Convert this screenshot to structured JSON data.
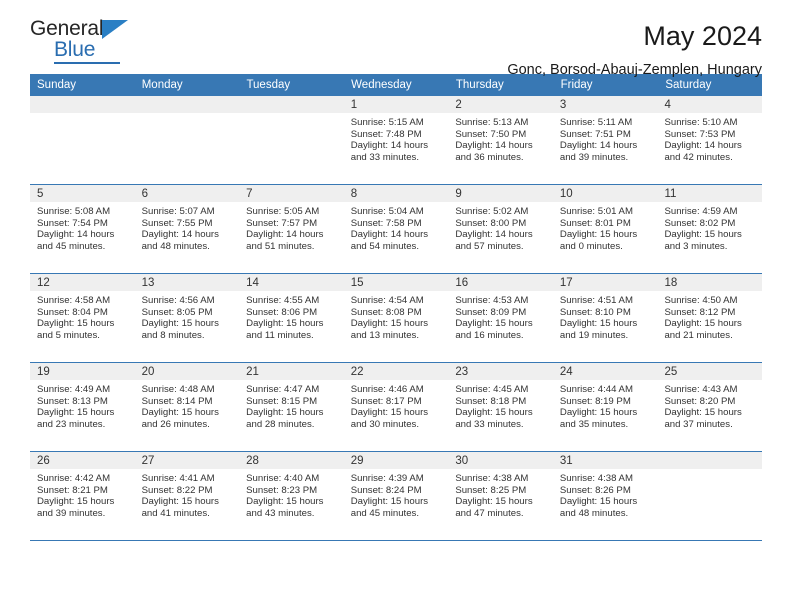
{
  "brand": {
    "name_top": "General",
    "name_bottom": "Blue",
    "triangle_icon": "blue-triangle-icon",
    "accent_color": "#2a6db0"
  },
  "header": {
    "title": "May 2024",
    "subtitle": "Gonc, Borsod-Abauj-Zemplen, Hungary"
  },
  "calendar": {
    "header_bg": "#3878b4",
    "band_bg": "#efefef",
    "weekdays": [
      "Sunday",
      "Monday",
      "Tuesday",
      "Wednesday",
      "Thursday",
      "Friday",
      "Saturday"
    ],
    "weeks": [
      [
        {
          "day": "",
          "sunrise": "",
          "sunset": "",
          "daylight1": "",
          "daylight2": ""
        },
        {
          "day": "",
          "sunrise": "",
          "sunset": "",
          "daylight1": "",
          "daylight2": ""
        },
        {
          "day": "",
          "sunrise": "",
          "sunset": "",
          "daylight1": "",
          "daylight2": ""
        },
        {
          "day": "1",
          "sunrise": "Sunrise: 5:15 AM",
          "sunset": "Sunset: 7:48 PM",
          "daylight1": "Daylight: 14 hours",
          "daylight2": "and 33 minutes."
        },
        {
          "day": "2",
          "sunrise": "Sunrise: 5:13 AM",
          "sunset": "Sunset: 7:50 PM",
          "daylight1": "Daylight: 14 hours",
          "daylight2": "and 36 minutes."
        },
        {
          "day": "3",
          "sunrise": "Sunrise: 5:11 AM",
          "sunset": "Sunset: 7:51 PM",
          "daylight1": "Daylight: 14 hours",
          "daylight2": "and 39 minutes."
        },
        {
          "day": "4",
          "sunrise": "Sunrise: 5:10 AM",
          "sunset": "Sunset: 7:53 PM",
          "daylight1": "Daylight: 14 hours",
          "daylight2": "and 42 minutes."
        }
      ],
      [
        {
          "day": "5",
          "sunrise": "Sunrise: 5:08 AM",
          "sunset": "Sunset: 7:54 PM",
          "daylight1": "Daylight: 14 hours",
          "daylight2": "and 45 minutes."
        },
        {
          "day": "6",
          "sunrise": "Sunrise: 5:07 AM",
          "sunset": "Sunset: 7:55 PM",
          "daylight1": "Daylight: 14 hours",
          "daylight2": "and 48 minutes."
        },
        {
          "day": "7",
          "sunrise": "Sunrise: 5:05 AM",
          "sunset": "Sunset: 7:57 PM",
          "daylight1": "Daylight: 14 hours",
          "daylight2": "and 51 minutes."
        },
        {
          "day": "8",
          "sunrise": "Sunrise: 5:04 AM",
          "sunset": "Sunset: 7:58 PM",
          "daylight1": "Daylight: 14 hours",
          "daylight2": "and 54 minutes."
        },
        {
          "day": "9",
          "sunrise": "Sunrise: 5:02 AM",
          "sunset": "Sunset: 8:00 PM",
          "daylight1": "Daylight: 14 hours",
          "daylight2": "and 57 minutes."
        },
        {
          "day": "10",
          "sunrise": "Sunrise: 5:01 AM",
          "sunset": "Sunset: 8:01 PM",
          "daylight1": "Daylight: 15 hours",
          "daylight2": "and 0 minutes."
        },
        {
          "day": "11",
          "sunrise": "Sunrise: 4:59 AM",
          "sunset": "Sunset: 8:02 PM",
          "daylight1": "Daylight: 15 hours",
          "daylight2": "and 3 minutes."
        }
      ],
      [
        {
          "day": "12",
          "sunrise": "Sunrise: 4:58 AM",
          "sunset": "Sunset: 8:04 PM",
          "daylight1": "Daylight: 15 hours",
          "daylight2": "and 5 minutes."
        },
        {
          "day": "13",
          "sunrise": "Sunrise: 4:56 AM",
          "sunset": "Sunset: 8:05 PM",
          "daylight1": "Daylight: 15 hours",
          "daylight2": "and 8 minutes."
        },
        {
          "day": "14",
          "sunrise": "Sunrise: 4:55 AM",
          "sunset": "Sunset: 8:06 PM",
          "daylight1": "Daylight: 15 hours",
          "daylight2": "and 11 minutes."
        },
        {
          "day": "15",
          "sunrise": "Sunrise: 4:54 AM",
          "sunset": "Sunset: 8:08 PM",
          "daylight1": "Daylight: 15 hours",
          "daylight2": "and 13 minutes."
        },
        {
          "day": "16",
          "sunrise": "Sunrise: 4:53 AM",
          "sunset": "Sunset: 8:09 PM",
          "daylight1": "Daylight: 15 hours",
          "daylight2": "and 16 minutes."
        },
        {
          "day": "17",
          "sunrise": "Sunrise: 4:51 AM",
          "sunset": "Sunset: 8:10 PM",
          "daylight1": "Daylight: 15 hours",
          "daylight2": "and 19 minutes."
        },
        {
          "day": "18",
          "sunrise": "Sunrise: 4:50 AM",
          "sunset": "Sunset: 8:12 PM",
          "daylight1": "Daylight: 15 hours",
          "daylight2": "and 21 minutes."
        }
      ],
      [
        {
          "day": "19",
          "sunrise": "Sunrise: 4:49 AM",
          "sunset": "Sunset: 8:13 PM",
          "daylight1": "Daylight: 15 hours",
          "daylight2": "and 23 minutes."
        },
        {
          "day": "20",
          "sunrise": "Sunrise: 4:48 AM",
          "sunset": "Sunset: 8:14 PM",
          "daylight1": "Daylight: 15 hours",
          "daylight2": "and 26 minutes."
        },
        {
          "day": "21",
          "sunrise": "Sunrise: 4:47 AM",
          "sunset": "Sunset: 8:15 PM",
          "daylight1": "Daylight: 15 hours",
          "daylight2": "and 28 minutes."
        },
        {
          "day": "22",
          "sunrise": "Sunrise: 4:46 AM",
          "sunset": "Sunset: 8:17 PM",
          "daylight1": "Daylight: 15 hours",
          "daylight2": "and 30 minutes."
        },
        {
          "day": "23",
          "sunrise": "Sunrise: 4:45 AM",
          "sunset": "Sunset: 8:18 PM",
          "daylight1": "Daylight: 15 hours",
          "daylight2": "and 33 minutes."
        },
        {
          "day": "24",
          "sunrise": "Sunrise: 4:44 AM",
          "sunset": "Sunset: 8:19 PM",
          "daylight1": "Daylight: 15 hours",
          "daylight2": "and 35 minutes."
        },
        {
          "day": "25",
          "sunrise": "Sunrise: 4:43 AM",
          "sunset": "Sunset: 8:20 PM",
          "daylight1": "Daylight: 15 hours",
          "daylight2": "and 37 minutes."
        }
      ],
      [
        {
          "day": "26",
          "sunrise": "Sunrise: 4:42 AM",
          "sunset": "Sunset: 8:21 PM",
          "daylight1": "Daylight: 15 hours",
          "daylight2": "and 39 minutes."
        },
        {
          "day": "27",
          "sunrise": "Sunrise: 4:41 AM",
          "sunset": "Sunset: 8:22 PM",
          "daylight1": "Daylight: 15 hours",
          "daylight2": "and 41 minutes."
        },
        {
          "day": "28",
          "sunrise": "Sunrise: 4:40 AM",
          "sunset": "Sunset: 8:23 PM",
          "daylight1": "Daylight: 15 hours",
          "daylight2": "and 43 minutes."
        },
        {
          "day": "29",
          "sunrise": "Sunrise: 4:39 AM",
          "sunset": "Sunset: 8:24 PM",
          "daylight1": "Daylight: 15 hours",
          "daylight2": "and 45 minutes."
        },
        {
          "day": "30",
          "sunrise": "Sunrise: 4:38 AM",
          "sunset": "Sunset: 8:25 PM",
          "daylight1": "Daylight: 15 hours",
          "daylight2": "and 47 minutes."
        },
        {
          "day": "31",
          "sunrise": "Sunrise: 4:38 AM",
          "sunset": "Sunset: 8:26 PM",
          "daylight1": "Daylight: 15 hours",
          "daylight2": "and 48 minutes."
        },
        {
          "day": "",
          "sunrise": "",
          "sunset": "",
          "daylight1": "",
          "daylight2": ""
        }
      ]
    ]
  }
}
